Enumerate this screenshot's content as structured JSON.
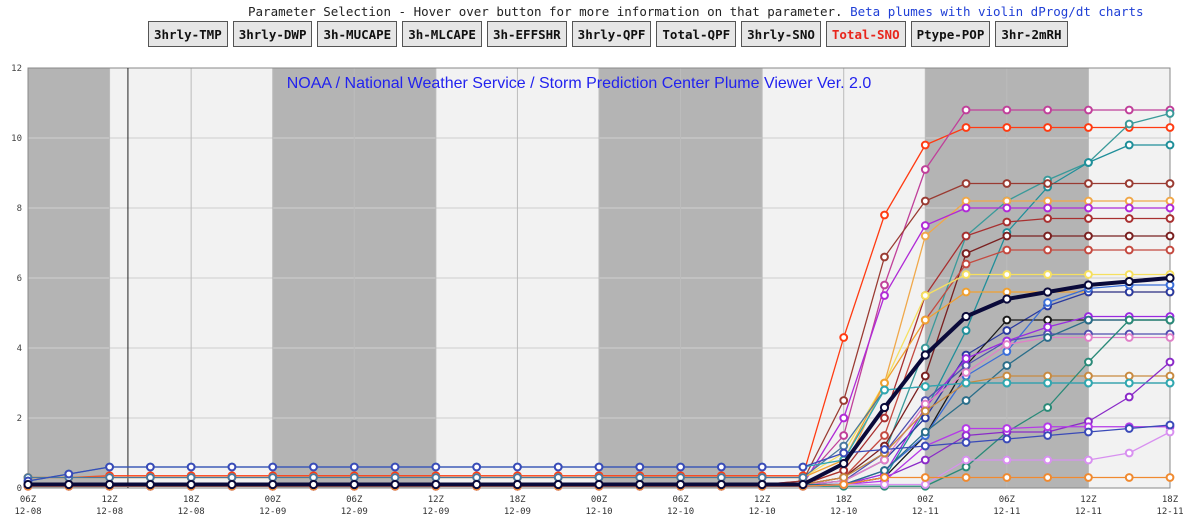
{
  "header": {
    "selection_text": "Parameter Selection - Hover over button for more information on that parameter.",
    "beta_link": "Beta plumes with violin dProg/dt charts"
  },
  "buttons": [
    {
      "label": "3hrly-TMP",
      "active": false
    },
    {
      "label": "3hrly-DWP",
      "active": false
    },
    {
      "label": "3h-MUCAPE",
      "active": false
    },
    {
      "label": "3h-MLCAPE",
      "active": false
    },
    {
      "label": "3h-EFFSHR",
      "active": false
    },
    {
      "label": "3hrly-QPF",
      "active": false
    },
    {
      "label": "Total-QPF",
      "active": false
    },
    {
      "label": "3hrly-SNO",
      "active": false
    },
    {
      "label": "Total-SNO",
      "active": true
    },
    {
      "label": "Ptype-POP",
      "active": false
    },
    {
      "label": "3hr-2mRH",
      "active": false
    }
  ],
  "chart_data": {
    "type": "line",
    "title": "NOAA / National Weather Service / Storm Prediction Center Plume Viewer Ver. 2.0",
    "ylim": [
      0,
      12
    ],
    "yticks": [
      0,
      2,
      4,
      6,
      8,
      10,
      12
    ],
    "xlim": [
      0,
      28
    ],
    "x_ticks": [
      {
        "t": "06Z",
        "d": "12-08"
      },
      {
        "t": "12Z",
        "d": "12-08"
      },
      {
        "t": "18Z",
        "d": "12-08"
      },
      {
        "t": "00Z",
        "d": "12-09"
      },
      {
        "t": "06Z",
        "d": "12-09"
      },
      {
        "t": "12Z",
        "d": "12-09"
      },
      {
        "t": "18Z",
        "d": "12-09"
      },
      {
        "t": "00Z",
        "d": "12-10"
      },
      {
        "t": "06Z",
        "d": "12-10"
      },
      {
        "t": "12Z",
        "d": "12-10"
      },
      {
        "t": "18Z",
        "d": "12-10"
      },
      {
        "t": "00Z",
        "d": "12-11"
      },
      {
        "t": "06Z",
        "d": "12-11"
      },
      {
        "t": "12Z",
        "d": "12-11"
      },
      {
        "t": "18Z",
        "d": "12-11"
      }
    ],
    "grid": true,
    "shaded_night_blocks": [
      [
        0,
        2
      ],
      [
        6,
        10
      ],
      [
        14,
        18
      ],
      [
        22,
        26
      ]
    ],
    "current_time_x": 2.45,
    "series": [
      {
        "color": "#ff3b12",
        "values": [
          0.3,
          0.3,
          0.35,
          0.35,
          0.35,
          0.35,
          0.35,
          0.35,
          0.35,
          0.35,
          0.35,
          0.35,
          0.35,
          0.35,
          0.35,
          0.35,
          0.35,
          0.35,
          0.35,
          0.35,
          4.3,
          7.8,
          9.8,
          10.3,
          10.3,
          10.3,
          10.3,
          10.3,
          10.3
        ]
      },
      {
        "color": "#c0409a",
        "values": [
          0.1,
          0.1,
          0.1,
          0.1,
          0.1,
          0.1,
          0.1,
          0.1,
          0.1,
          0.1,
          0.1,
          0.1,
          0.1,
          0.1,
          0.1,
          0.1,
          0.1,
          0.1,
          0.1,
          0.2,
          1.5,
          5.8,
          9.1,
          10.8,
          10.8,
          10.8,
          10.8,
          10.8,
          10.8
        ]
      },
      {
        "color": "#3a9a9a",
        "values": [
          0.1,
          0.1,
          0.1,
          0.1,
          0.1,
          0.1,
          0.1,
          0.1,
          0.1,
          0.1,
          0.1,
          0.1,
          0.1,
          0.1,
          0.1,
          0.1,
          0.1,
          0.1,
          0.1,
          0.1,
          0.3,
          1.0,
          4.0,
          7.2,
          8.2,
          8.8,
          9.3,
          10.4,
          10.7
        ]
      },
      {
        "color": "#1f8f9a",
        "values": [
          0.05,
          0.05,
          0.05,
          0.05,
          0.05,
          0.05,
          0.05,
          0.05,
          0.05,
          0.05,
          0.05,
          0.05,
          0.05,
          0.05,
          0.05,
          0.05,
          0.05,
          0.05,
          0.05,
          0.05,
          0.1,
          0.3,
          2.2,
          4.5,
          7.3,
          8.6,
          9.3,
          9.8,
          9.8
        ]
      },
      {
        "color": "#9a3b32",
        "values": [
          0.1,
          0.1,
          0.1,
          0.1,
          0.1,
          0.1,
          0.1,
          0.1,
          0.1,
          0.1,
          0.1,
          0.1,
          0.1,
          0.1,
          0.1,
          0.1,
          0.1,
          0.1,
          0.1,
          0.2,
          2.5,
          6.6,
          8.2,
          8.7,
          8.7,
          8.7,
          8.7,
          8.7,
          8.7
        ]
      },
      {
        "color": "#f0a84a",
        "values": [
          0.1,
          0.1,
          0.1,
          0.1,
          0.1,
          0.1,
          0.1,
          0.1,
          0.1,
          0.1,
          0.1,
          0.1,
          0.1,
          0.1,
          0.1,
          0.1,
          0.1,
          0.1,
          0.1,
          0.1,
          0.5,
          3.0,
          7.2,
          8.2,
          8.2,
          8.2,
          8.2,
          8.2,
          8.2
        ]
      },
      {
        "color": "#b02ad6",
        "values": [
          0.1,
          0.1,
          0.1,
          0.1,
          0.1,
          0.1,
          0.1,
          0.1,
          0.1,
          0.1,
          0.1,
          0.1,
          0.1,
          0.1,
          0.1,
          0.1,
          0.1,
          0.1,
          0.1,
          0.1,
          2.0,
          5.5,
          7.5,
          8.0,
          8.0,
          8.0,
          8.0,
          8.0,
          8.0
        ]
      },
      {
        "color": "#a83030",
        "values": [
          0.1,
          0.1,
          0.1,
          0.1,
          0.1,
          0.1,
          0.1,
          0.1,
          0.1,
          0.1,
          0.1,
          0.1,
          0.1,
          0.1,
          0.1,
          0.1,
          0.1,
          0.1,
          0.1,
          0.1,
          0.5,
          2.0,
          5.5,
          7.2,
          7.6,
          7.7,
          7.7,
          7.7,
          7.7
        ]
      },
      {
        "color": "#7a2020",
        "values": [
          0.1,
          0.1,
          0.1,
          0.1,
          0.1,
          0.1,
          0.1,
          0.1,
          0.1,
          0.1,
          0.1,
          0.1,
          0.1,
          0.1,
          0.1,
          0.1,
          0.1,
          0.1,
          0.1,
          0.1,
          0.3,
          1.2,
          3.2,
          6.7,
          7.2,
          7.2,
          7.2,
          7.2,
          7.2
        ]
      },
      {
        "color": "#c44a40",
        "values": [
          0.1,
          0.1,
          0.1,
          0.1,
          0.1,
          0.1,
          0.1,
          0.1,
          0.1,
          0.1,
          0.1,
          0.1,
          0.1,
          0.1,
          0.1,
          0.1,
          0.1,
          0.1,
          0.1,
          0.1,
          0.3,
          1.5,
          4.8,
          6.4,
          6.8,
          6.8,
          6.8,
          6.8,
          6.8
        ]
      },
      {
        "color": "#f6e060",
        "values": [
          0.3,
          0.3,
          0.3,
          0.3,
          0.3,
          0.3,
          0.3,
          0.3,
          0.3,
          0.3,
          0.3,
          0.3,
          0.3,
          0.3,
          0.3,
          0.3,
          0.3,
          0.3,
          0.3,
          0.3,
          1.0,
          3.0,
          5.5,
          6.1,
          6.1,
          6.1,
          6.1,
          6.1,
          6.1
        ]
      },
      {
        "color": "#f0a030",
        "values": [
          0.3,
          0.3,
          0.3,
          0.3,
          0.3,
          0.3,
          0.3,
          0.3,
          0.3,
          0.3,
          0.3,
          0.3,
          0.3,
          0.3,
          0.3,
          0.3,
          0.3,
          0.3,
          0.3,
          0.3,
          0.8,
          3.0,
          4.8,
          5.6,
          5.6,
          5.6,
          5.6,
          5.6,
          5.6
        ]
      },
      {
        "color": "#2a3aa0",
        "values": [
          0.1,
          0.1,
          0.1,
          0.1,
          0.1,
          0.1,
          0.1,
          0.1,
          0.1,
          0.1,
          0.1,
          0.1,
          0.1,
          0.1,
          0.1,
          0.1,
          0.1,
          0.1,
          0.1,
          0.1,
          0.2,
          0.8,
          2.0,
          3.8,
          4.5,
          5.2,
          5.6,
          5.6,
          5.6
        ]
      },
      {
        "color": "#1a1a1a",
        "values": [
          0.1,
          0.1,
          0.1,
          0.1,
          0.1,
          0.1,
          0.1,
          0.1,
          0.1,
          0.1,
          0.1,
          0.1,
          0.1,
          0.1,
          0.1,
          0.1,
          0.1,
          0.1,
          0.1,
          0.1,
          0.1,
          0.3,
          1.5,
          3.5,
          4.8,
          4.8,
          4.8,
          4.8,
          4.8
        ]
      },
      {
        "color": "#3a6ed8",
        "values": [
          0.1,
          0.1,
          0.1,
          0.1,
          0.1,
          0.1,
          0.1,
          0.1,
          0.1,
          0.1,
          0.1,
          0.1,
          0.1,
          0.1,
          0.1,
          0.1,
          0.1,
          0.1,
          0.1,
          0.1,
          0.1,
          0.5,
          1.5,
          3.2,
          3.9,
          5.3,
          5.7,
          5.8,
          5.8
        ]
      },
      {
        "color": "#5050b0",
        "values": [
          0.1,
          0.1,
          0.1,
          0.1,
          0.1,
          0.1,
          0.1,
          0.1,
          0.1,
          0.1,
          0.1,
          0.1,
          0.1,
          0.1,
          0.1,
          0.1,
          0.1,
          0.1,
          0.1,
          0.1,
          0.2,
          1.0,
          2.5,
          3.5,
          4.2,
          4.4,
          4.4,
          4.4,
          4.4
        ]
      },
      {
        "color": "#9a2be0",
        "values": [
          0.1,
          0.1,
          0.1,
          0.1,
          0.1,
          0.1,
          0.1,
          0.1,
          0.1,
          0.1,
          0.1,
          0.1,
          0.1,
          0.1,
          0.1,
          0.1,
          0.1,
          0.1,
          0.1,
          0.1,
          0.1,
          0.4,
          2.3,
          3.7,
          4.2,
          4.6,
          4.9,
          4.9,
          4.9
        ]
      },
      {
        "color": "#e080c8",
        "values": [
          0.1,
          0.1,
          0.1,
          0.1,
          0.1,
          0.1,
          0.1,
          0.1,
          0.1,
          0.1,
          0.1,
          0.1,
          0.1,
          0.1,
          0.1,
          0.1,
          0.1,
          0.1,
          0.1,
          0.1,
          0.2,
          0.8,
          2.4,
          3.3,
          4.1,
          4.3,
          4.3,
          4.3,
          4.3
        ]
      },
      {
        "color": "#2a6e8a",
        "values": [
          0.1,
          0.1,
          0.1,
          0.1,
          0.1,
          0.1,
          0.1,
          0.1,
          0.1,
          0.1,
          0.1,
          0.1,
          0.1,
          0.1,
          0.1,
          0.1,
          0.1,
          0.1,
          0.1,
          0.1,
          0.1,
          0.5,
          1.6,
          2.5,
          3.5,
          4.3,
          4.8,
          4.8,
          4.8
        ]
      },
      {
        "color": "#4a78a0",
        "values": [
          0.3,
          0.3,
          0.3,
          0.3,
          0.3,
          0.3,
          0.3,
          0.3,
          0.3,
          0.3,
          0.3,
          0.3,
          0.3,
          0.3,
          0.3,
          0.3,
          0.3,
          0.3,
          0.3,
          0.3,
          1.2,
          2.8,
          2.9,
          3.0,
          3.0,
          3.0,
          3.0,
          3.0,
          3.0
        ]
      },
      {
        "color": "#c88a40",
        "values": [
          0.1,
          0.1,
          0.1,
          0.1,
          0.1,
          0.1,
          0.1,
          0.1,
          0.1,
          0.1,
          0.1,
          0.1,
          0.1,
          0.1,
          0.1,
          0.1,
          0.1,
          0.1,
          0.1,
          0.1,
          0.3,
          1.0,
          2.2,
          3.0,
          3.2,
          3.2,
          3.2,
          3.2,
          3.2
        ]
      },
      {
        "color": "#2a8a78",
        "values": [
          0.05,
          0.05,
          0.05,
          0.05,
          0.05,
          0.05,
          0.05,
          0.05,
          0.05,
          0.05,
          0.05,
          0.05,
          0.05,
          0.05,
          0.05,
          0.05,
          0.05,
          0.05,
          0.05,
          0.05,
          0.05,
          0.05,
          0.05,
          0.6,
          1.6,
          2.3,
          3.6,
          4.8,
          4.8
        ]
      },
      {
        "color": "#8a2ac8",
        "values": [
          0.05,
          0.05,
          0.05,
          0.05,
          0.05,
          0.05,
          0.05,
          0.05,
          0.05,
          0.05,
          0.05,
          0.05,
          0.05,
          0.05,
          0.05,
          0.05,
          0.05,
          0.05,
          0.05,
          0.05,
          0.1,
          0.3,
          0.8,
          1.5,
          1.6,
          1.6,
          1.9,
          2.6,
          3.6
        ]
      },
      {
        "color": "#b53ae8",
        "values": [
          0.05,
          0.05,
          0.05,
          0.05,
          0.05,
          0.05,
          0.05,
          0.05,
          0.05,
          0.05,
          0.05,
          0.05,
          0.05,
          0.05,
          0.05,
          0.05,
          0.05,
          0.05,
          0.05,
          0.05,
          0.1,
          0.2,
          1.2,
          1.7,
          1.7,
          1.75,
          1.75,
          1.75,
          1.75
        ]
      },
      {
        "color": "#d890f0",
        "values": [
          0.05,
          0.05,
          0.05,
          0.05,
          0.05,
          0.05,
          0.05,
          0.05,
          0.05,
          0.05,
          0.05,
          0.05,
          0.05,
          0.05,
          0.05,
          0.05,
          0.05,
          0.05,
          0.05,
          0.05,
          0.1,
          0.1,
          0.1,
          0.8,
          0.8,
          0.8,
          0.8,
          1.0,
          1.6
        ]
      },
      {
        "color": "#f08a30",
        "values": [
          0.05,
          0.05,
          0.05,
          0.05,
          0.05,
          0.05,
          0.05,
          0.05,
          0.05,
          0.05,
          0.05,
          0.05,
          0.05,
          0.05,
          0.05,
          0.05,
          0.05,
          0.05,
          0.05,
          0.05,
          0.1,
          0.3,
          0.3,
          0.3,
          0.3,
          0.3,
          0.3,
          0.3,
          0.3
        ]
      },
      {
        "color": "#30a8b0",
        "values": [
          0.2,
          0.4,
          0.6,
          0.6,
          0.6,
          0.6,
          0.6,
          0.6,
          0.6,
          0.6,
          0.6,
          0.6,
          0.6,
          0.6,
          0.6,
          0.6,
          0.6,
          0.6,
          0.6,
          0.6,
          0.8,
          2.8,
          2.9,
          3.0,
          3.0,
          3.0,
          3.0,
          3.0,
          3.0
        ]
      },
      {
        "color": "#3a4ab8",
        "values": [
          0.2,
          0.4,
          0.6,
          0.6,
          0.6,
          0.6,
          0.6,
          0.6,
          0.6,
          0.6,
          0.6,
          0.6,
          0.6,
          0.6,
          0.6,
          0.6,
          0.6,
          0.6,
          0.6,
          0.6,
          1.0,
          1.1,
          1.2,
          1.3,
          1.4,
          1.5,
          1.6,
          1.7,
          1.8
        ]
      }
    ],
    "mean_series": {
      "color": "#0a0a3a",
      "values": [
        0.1,
        0.1,
        0.1,
        0.1,
        0.1,
        0.1,
        0.1,
        0.1,
        0.1,
        0.1,
        0.1,
        0.1,
        0.1,
        0.1,
        0.1,
        0.1,
        0.1,
        0.1,
        0.1,
        0.1,
        0.7,
        2.3,
        3.8,
        4.9,
        5.4,
        5.6,
        5.8,
        5.9,
        6.0
      ]
    }
  }
}
